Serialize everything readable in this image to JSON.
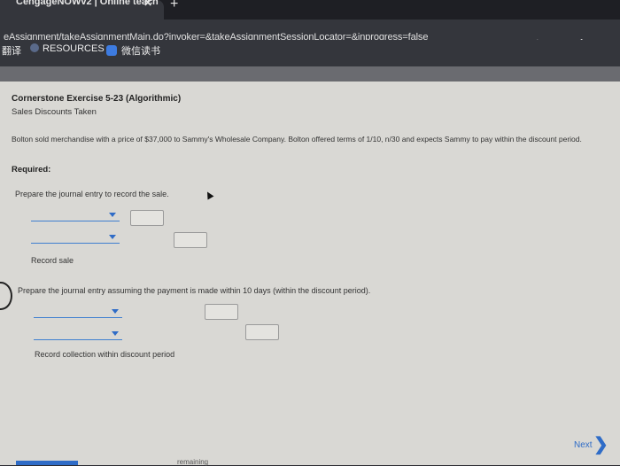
{
  "browser": {
    "tab_title": "CengageNOWv2 | Online teach",
    "tab_close": "✕",
    "new_tab": "+",
    "url_visible": "eAssignment/takeAssignmentMain.do?invoker=&takeAssignmentSessionLocator=&inprogress=false",
    "url_rest": "",
    "bookmarks": [
      "翻译",
      "RESOURCES",
      "微信读书"
    ]
  },
  "assignment": {
    "title": "Cornerstone Exercise 5-23 (Algorithmic)",
    "subtitle": "Sales Discounts Taken",
    "paragraph": "Bolton sold merchandise with a price of $37,000 to Sammy's Wholesale Company. Bolton offered terms of 1/10, n/30 and expects Sammy to pay within the discount period.",
    "required": "Required:",
    "q1_prompt": "Prepare the journal entry to record the sale.",
    "q1_note": "Record sale",
    "q2_prompt": "Prepare the journal entry assuming the payment is made within 10 days (within the discount period).",
    "q2_note": "Record collection within discount period"
  },
  "footer": {
    "next_label": "Next",
    "next_chevron": "❯",
    "remaining_text": "remaining"
  },
  "icons": {
    "star": "☆",
    "puzzle": "✱"
  }
}
